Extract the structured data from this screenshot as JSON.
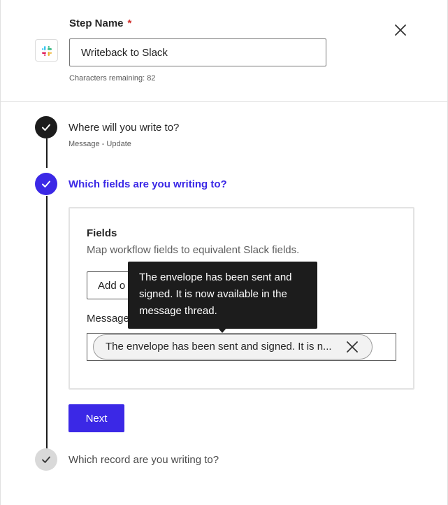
{
  "header": {
    "app_icon": "slack-logo-icon",
    "step_name_label": "Step Name",
    "required_marker": "*",
    "step_name_value": "Writeback to Slack",
    "chars_remaining": "Characters remaining: 82",
    "close_icon": "close-icon"
  },
  "steps": [
    {
      "title": "Where will you write to?",
      "subtitle": "Message - Update",
      "state": "done"
    },
    {
      "title": "Which fields are you writing to?",
      "state": "active"
    },
    {
      "title": "Which record are you writing to?",
      "state": "pending"
    }
  ],
  "fields": {
    "title": "Fields",
    "description": "Map workflow fields to equivalent Slack fields.",
    "add_button_label": "Add o",
    "message_label": "Message",
    "message_pill_text": "The envelope has been sent and signed. It is n...",
    "tooltip_text": "The envelope has been sent and signed. It is now available in the message thread."
  },
  "actions": {
    "next_label": "Next"
  },
  "colors": {
    "accent": "#3b28e6",
    "done": "#1c1c1c",
    "pending": "#d9d9d9",
    "required": "#d0312d"
  }
}
